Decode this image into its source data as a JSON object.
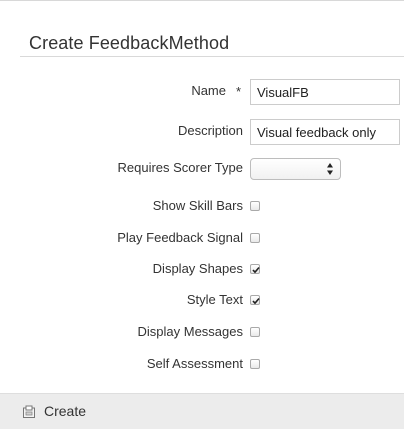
{
  "form": {
    "title": "Create FeedbackMethod",
    "fields": {
      "name": {
        "label": "Name",
        "required_marker": "*",
        "value": "VisualFB"
      },
      "description": {
        "label": "Description",
        "value": "Visual feedback only"
      },
      "requires_scorer_type": {
        "label": "Requires Scorer Type",
        "selected": ""
      },
      "show_skill_bars": {
        "label": "Show Skill Bars",
        "checked": false
      },
      "play_feedback_signal": {
        "label": "Play Feedback Signal",
        "checked": false
      },
      "display_shapes": {
        "label": "Display Shapes",
        "checked": true
      },
      "style_text": {
        "label": "Style Text",
        "checked": true
      },
      "display_messages": {
        "label": "Display Messages",
        "checked": false
      },
      "self_assessment": {
        "label": "Self Assessment",
        "checked": false
      }
    }
  },
  "footer": {
    "create_label": "Create",
    "create_icon": "create-icon"
  }
}
